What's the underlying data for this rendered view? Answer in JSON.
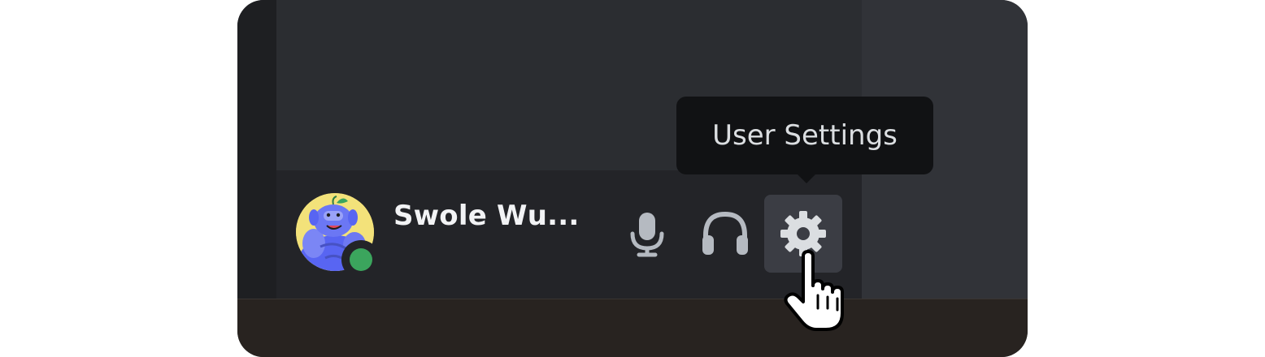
{
  "user_panel": {
    "username": "Swole Wu...",
    "status": "online",
    "avatar_icon": "wumpus-avatar",
    "status_icon": "online-status-dot"
  },
  "controls": {
    "mic_icon": "microphone-icon",
    "headset_icon": "headphones-icon",
    "settings_icon": "gear-icon"
  },
  "tooltip": {
    "text": "User Settings"
  },
  "colors": {
    "status_online": "#3ba55d",
    "panel_bg": "#232428",
    "tooltip_bg": "#111214",
    "avatar_bg": "#f3e27a",
    "wumpus_blue": "#5865f2"
  },
  "cursor": {
    "icon": "hand-pointer-cursor"
  }
}
